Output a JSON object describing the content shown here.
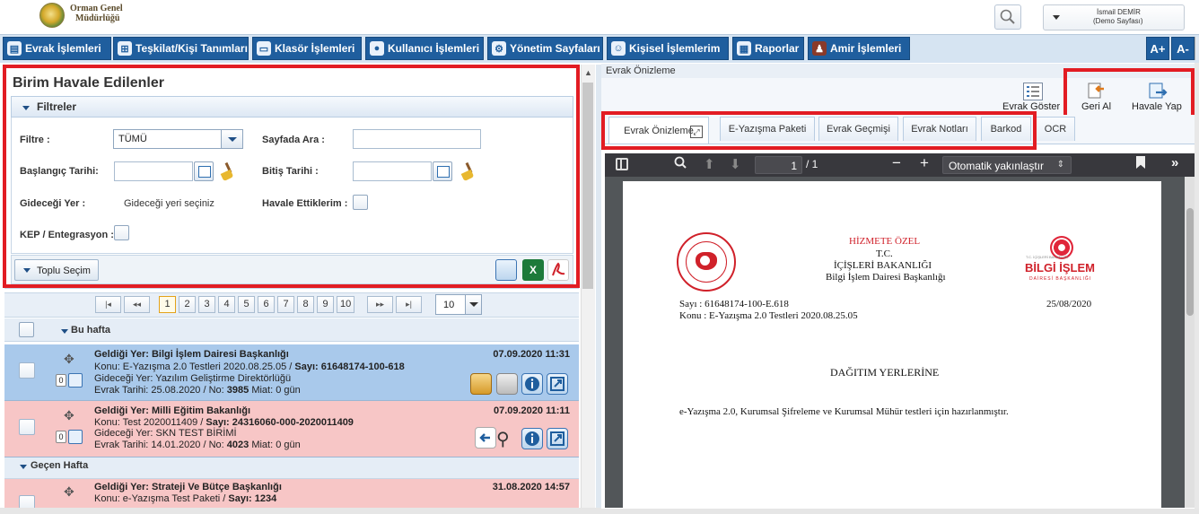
{
  "header": {
    "org_line1": "Orman Genel",
    "org_line2": "Müdürlüğü",
    "user_name": "İsmail DEMİR",
    "user_role": "(Demo Sayfası)"
  },
  "menu": {
    "items": [
      {
        "label": "Evrak İşlemleri",
        "icon": "document-icon"
      },
      {
        "label": "Teşkilat/Kişi Tanımları",
        "icon": "org-tree-icon"
      },
      {
        "label": "Klasör İşlemleri",
        "icon": "folder-icon"
      },
      {
        "label": "Kullanıcı İşlemleri",
        "icon": "user-icon"
      },
      {
        "label": "Yönetim Sayfaları",
        "icon": "admin-icon"
      },
      {
        "label": "Kişisel İşlemlerim",
        "icon": "personal-icon"
      },
      {
        "label": "Raporlar",
        "icon": "report-icon"
      },
      {
        "label": "Amir İşlemleri",
        "icon": "manager-icon"
      }
    ],
    "font_up": "A+",
    "font_down": "A-"
  },
  "left": {
    "title": "Birim Havale Edilenler",
    "filters_title": "Filtreler",
    "filter_label": "Filtre :",
    "filter_value": "TÜMÜ",
    "page_search_label": "Sayfada Ara :",
    "start_date_label": "Başlangıç Tarihi:",
    "end_date_label": "Bitiş Tarihi :",
    "destination_label": "Gideceği Yer :",
    "destination_placeholder": "Gideceği yeri seçiniz",
    "forwarded_label": "Havale Ettiklerim :",
    "kep_label": "KEP / Entegrasyon :",
    "bulk_select": "Toplu Seçim"
  },
  "pager": {
    "pages": [
      "1",
      "2",
      "3",
      "4",
      "5",
      "6",
      "7",
      "8",
      "9",
      "10"
    ],
    "current": "1",
    "first": "|◂",
    "prev": "◂◂",
    "next": "▸▸",
    "last": "▸|",
    "page_size": "10"
  },
  "list": {
    "group_this_week": "Bu hafta",
    "group_last_week": "Geçen Hafta",
    "rows": [
      {
        "from": "Geldiği Yer: Bilgi İşlem Dairesi Başkanlığı",
        "subject": "Konu: E-Yazışma 2.0 Testleri 2020.08.25.05 / ",
        "sayi_label": "Sayı: ",
        "sayi": "61648174-100-618",
        "dest": "Gideceği Yer: Yazılım Geliştirme Direktörlüğü",
        "evrak": "Evrak Tarihi: 25.08.2020 / No: ",
        "no": "3985",
        "miat": " Miat: 0 gün",
        "date": "07.09.2020 11:31",
        "count": "0",
        "color": "#a9c9eb"
      },
      {
        "from": "Geldiği Yer: Milli Eğitim Bakanlığı",
        "subject": "Konu: Test 2020011409 / ",
        "sayi_label": "Sayı: ",
        "sayi": "24316060-000-2020011409",
        "dest": "Gideceği Yer: SKN TEST BİRİMİ",
        "evrak": "Evrak Tarihi: 14.01.2020 / No: ",
        "no": "4023",
        "miat": " Miat: 0 gün",
        "date": "07.09.2020 11:11",
        "count": "0",
        "color": "#f7c6c6"
      },
      {
        "from": "Geldiği Yer: Strateji Ve Bütçe Başkanlığı",
        "subject": "Konu: e-Yazışma Test Paketi / ",
        "sayi_label": "Sayı: ",
        "sayi": "1234",
        "date": "31.08.2020 14:57",
        "count": "0",
        "color": "#f7c6c6"
      }
    ]
  },
  "right": {
    "panel_title": "Evrak Önizleme",
    "show_doc": "Evrak Göster",
    "take_back": "Geri Al",
    "forward": "Havale Yap",
    "tabs": [
      "Evrak Önizleme",
      "E-Yazışma Paketi",
      "Evrak Geçmişi",
      "Evrak Notları",
      "Barkod",
      "OCR"
    ]
  },
  "pdf": {
    "page_current": "1",
    "page_total": "/ 1",
    "zoom": "Otomatik yakınlaştır",
    "classification": "HİZMETE ÖZEL",
    "tc": "T.C.",
    "ministry": "İÇİŞLERİ BAKANLIĞI",
    "dept": "Bilgi İşlem Dairesi Başkanlığı",
    "logo_title": "BİLGİ İŞLEM",
    "logo_sub": "DAİRESİ BAŞKANLIĞI",
    "logo_top": "T.C. İÇİŞLERİ BAKANLIĞI",
    "sayi": "Sayı :  61648174-100-E.618",
    "konu": "Konu : E-Yazışma 2.0 Testleri 2020.08.25.05",
    "date": "25/08/2020",
    "distribution": "DAĞITIM YERLERİNE",
    "body": "e-Yazışma 2.0, Kurumsal Şifreleme ve Kurumsal Mühür testleri için hazırlanmıştır."
  },
  "colors": {
    "menu_blue": "#1f5e9e",
    "highlight_red": "#e21c23",
    "row_selected": "#a9c9eb",
    "row_unread": "#f7c6c6",
    "pdf_red": "#d0212a"
  }
}
